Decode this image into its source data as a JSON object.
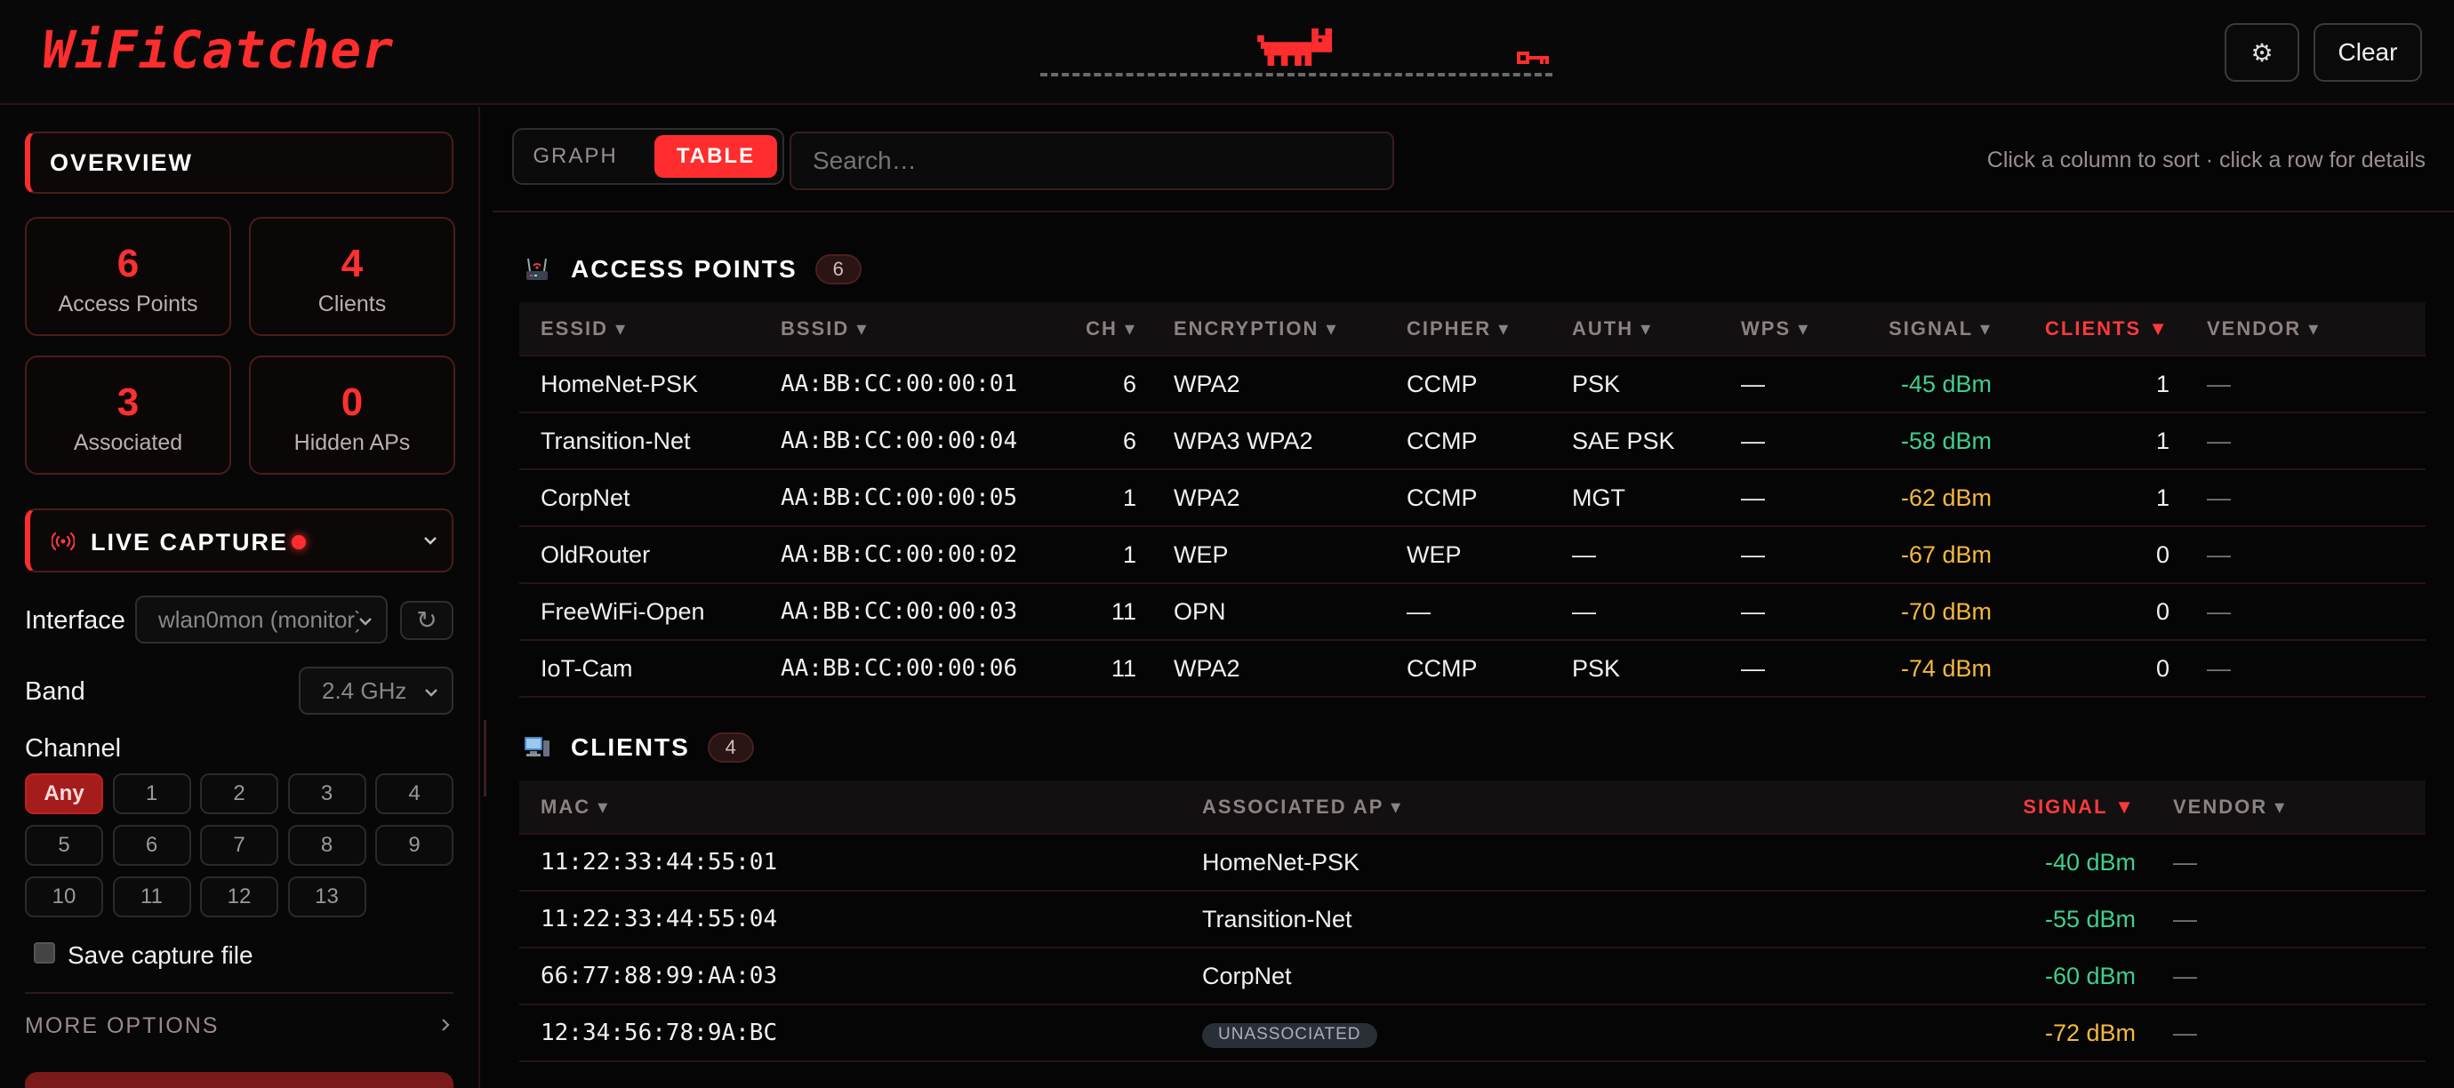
{
  "app": {
    "title": "WiFiCatcher",
    "settings_label": "⚙",
    "clear_label": "Clear"
  },
  "overview": {
    "title": "OVERVIEW",
    "stats": [
      {
        "value": "6",
        "label": "Access Points"
      },
      {
        "value": "4",
        "label": "Clients"
      },
      {
        "value": "3",
        "label": "Associated"
      },
      {
        "value": "0",
        "label": "Hidden APs"
      }
    ]
  },
  "live_capture": {
    "title": "LIVE CAPTURE",
    "interface_label": "Interface",
    "interface_value": "wlan0mon (monitor)",
    "refresh_label": "↻",
    "band_label": "Band",
    "band_value": "2.4 GHz",
    "channel_label": "Channel",
    "channels": [
      "Any",
      "1",
      "2",
      "3",
      "4",
      "5",
      "6",
      "7",
      "8",
      "9",
      "10",
      "11",
      "12",
      "13"
    ],
    "save_label": "Save capture file",
    "more_options": "MORE OPTIONS"
  },
  "view": {
    "graph_label": "GRAPH",
    "table_label": "TABLE",
    "search_placeholder": "Search…",
    "hint": "Click a column to sort · click a row for details"
  },
  "access_points": {
    "title": "ACCESS POINTS",
    "count": "6",
    "columns": [
      "ESSID ▾",
      "BSSID ▾",
      "CH ▾",
      "ENCRYPTION ▾",
      "CIPHER ▾",
      "AUTH ▾",
      "WPS ▾",
      "SIGNAL ▾",
      "CLIENTS ▼",
      "VENDOR ▾"
    ],
    "rows": [
      [
        "HomeNet-PSK",
        "AA:BB:CC:00:00:01",
        "6",
        "WPA2",
        "CCMP",
        "PSK",
        "—",
        "-45 dBm",
        "1",
        "—"
      ],
      [
        "Transition-Net",
        "AA:BB:CC:00:00:04",
        "6",
        "WPA3 WPA2",
        "CCMP",
        "SAE PSK",
        "—",
        "-58 dBm",
        "1",
        "—"
      ],
      [
        "CorpNet",
        "AA:BB:CC:00:00:05",
        "1",
        "WPA2",
        "CCMP",
        "MGT",
        "—",
        "-62 dBm",
        "1",
        "—"
      ],
      [
        "OldRouter",
        "AA:BB:CC:00:00:02",
        "1",
        "WEP",
        "WEP",
        "—",
        "—",
        "-67 dBm",
        "0",
        "—"
      ],
      [
        "FreeWiFi-Open",
        "AA:BB:CC:00:00:03",
        "11",
        "OPN",
        "—",
        "—",
        "—",
        "-70 dBm",
        "0",
        "—"
      ],
      [
        "IoT-Cam",
        "AA:BB:CC:00:00:06",
        "11",
        "WPA2",
        "CCMP",
        "PSK",
        "—",
        "-74 dBm",
        "0",
        "—"
      ]
    ]
  },
  "clients": {
    "title": "CLIENTS",
    "count": "4",
    "columns": [
      "MAC ▾",
      "ASSOCIATED AP ▾",
      "SIGNAL ▼",
      "VENDOR ▾"
    ],
    "rows": [
      [
        "11:22:33:44:55:01",
        "HomeNet-PSK",
        "-40 dBm",
        "—"
      ],
      [
        "11:22:33:44:55:04",
        "Transition-Net",
        "-55 dBm",
        "—"
      ],
      [
        "66:77:88:99:AA:03",
        "CorpNet",
        "-60 dBm",
        "—"
      ],
      [
        "12:34:56:78:9A:BC",
        "UNASSOCIATED",
        "-72 dBm",
        "—"
      ]
    ]
  },
  "colors": {
    "accent": "#ff2d2d",
    "signal_good": "#3ecf8e",
    "signal_mid": "#f5b83d"
  }
}
